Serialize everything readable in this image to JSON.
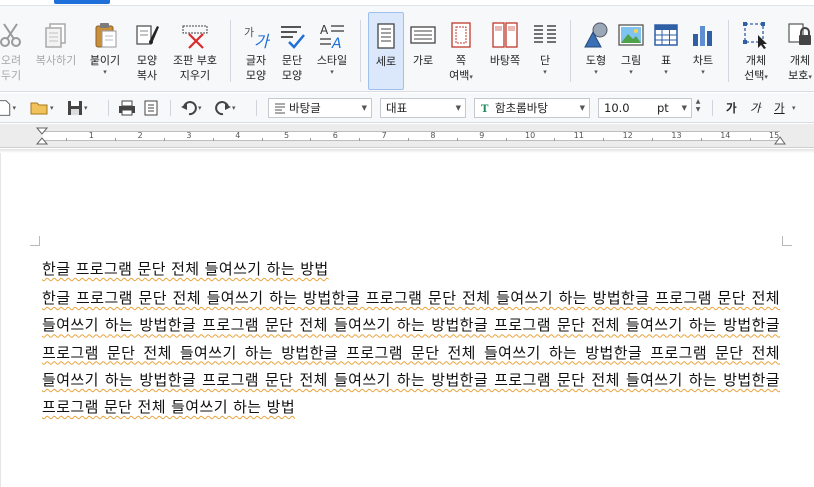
{
  "ribbon": {
    "buttons": [
      {
        "id": "cut",
        "label": [
          "오려",
          "두기"
        ],
        "disabled": true
      },
      {
        "id": "copy",
        "label": [
          "복사하기"
        ],
        "disabled": true
      },
      {
        "id": "paste",
        "label": [
          "붙이기"
        ],
        "dropdown": true
      },
      {
        "id": "format-copy",
        "label": [
          "모양",
          "복사"
        ]
      },
      {
        "id": "clear-layout",
        "label": [
          "조판 부호",
          "지우기"
        ]
      },
      {
        "id": "char-shape",
        "label": [
          "글자",
          "모양"
        ]
      },
      {
        "id": "para-shape",
        "label": [
          "문단",
          "모양"
        ]
      },
      {
        "id": "style",
        "label": [
          "스타일"
        ],
        "dropdown": true
      },
      {
        "id": "portrait",
        "label": [
          "세로"
        ],
        "active": true
      },
      {
        "id": "landscape",
        "label": [
          "가로"
        ]
      },
      {
        "id": "page-margin",
        "label": [
          "쪽",
          "여백"
        ],
        "dropdown": true
      },
      {
        "id": "page-bg",
        "label": [
          "바탕쪽"
        ]
      },
      {
        "id": "columns",
        "label": [
          "단"
        ],
        "dropdown": true
      },
      {
        "id": "shape",
        "label": [
          "도형"
        ],
        "dropdown": true
      },
      {
        "id": "picture",
        "label": [
          "그림"
        ],
        "dropdown": true
      },
      {
        "id": "table",
        "label": [
          "표"
        ],
        "dropdown": true
      },
      {
        "id": "chart",
        "label": [
          "차트"
        ],
        "dropdown": true
      },
      {
        "id": "object-select",
        "label": [
          "개체",
          "선택"
        ],
        "dropdown": true
      },
      {
        "id": "object-protect",
        "label": [
          "개체",
          "보호"
        ],
        "dropdown": true
      }
    ]
  },
  "toolbar2": {
    "font_lang": "바탕글",
    "font_category": "대표",
    "font_name": "함초롬바탕",
    "font_size": "10.0",
    "size_unit": "pt",
    "text_style_glyphs": [
      "가",
      "가",
      "가"
    ]
  },
  "ruler": {
    "numbers": [
      "1",
      "2",
      "3",
      "4",
      "5",
      "6",
      "7",
      "8",
      "9",
      "10",
      "11",
      "12",
      "13",
      "14",
      "15"
    ]
  },
  "document": {
    "title": "한글 프로그램 문단 전체 들여쓰기 하는 방법",
    "body": "한글 프로그램 문단 전체 들여쓰기 하는 방법한글 프로그램 문단 전체 들여쓰기 하는 방법한글 프로그램 문단 전체 들여쓰기 하는 방법한글 프로그램 문단 전체 들여쓰기 하는 방법한글 프로그램 문단 전체 들여쓰기 하는 방법한글 프로그램 문단 전체 들여쓰기 하는 방법한글 프로그램 문단 전체 들여쓰기 하는 방법한글 프로그램 문단 전체 들여쓰기 하는 방법한글 프로그램 문단 전체 들여쓰기 하는 방법한글 프로그램 문단 전체 들여쓰기 하는 방법한글 프로그램 문단 전체 들여쓰기 하는 방법"
  },
  "colors": {
    "accent": "#1e6fd9",
    "active_bg": "#dbe8fb",
    "spell_underline": "#e8a33c"
  }
}
